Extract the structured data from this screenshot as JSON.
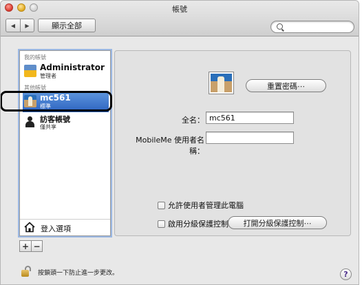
{
  "window": {
    "title": "帳號"
  },
  "toolbar": {
    "back_glyph": "◀",
    "forward_glyph": "▶",
    "show_all_label": "顯示全部",
    "search_placeholder": ""
  },
  "sidebar": {
    "my_account_header": "我的帳號",
    "other_accounts_header": "其他帳號",
    "accounts": [
      {
        "name": "Administrator",
        "role": "管理者",
        "icon": "sunflower-picture-icon"
      },
      {
        "name": "mc561",
        "role": "標準",
        "icon": "chess-picture-icon",
        "selected": true
      },
      {
        "name": "訪客帳號",
        "role": "僅共享",
        "icon": "guest-silhouette-icon"
      }
    ],
    "login_options_label": "登入選項",
    "add_label": "+",
    "remove_label": "−"
  },
  "panel": {
    "reset_password_label": "重置密碼⋯",
    "full_name_label": "全名：",
    "full_name_value": "mc561",
    "mobileme_label": "MobileMe 使用者名稱：",
    "mobileme_value": "",
    "allow_admin_label": "允許使用者管理此電腦",
    "allow_admin_checked": false,
    "parental_controls_label": "啟用分級保護控制",
    "parental_controls_checked": false,
    "open_parental_label": "打開分級保護控制⋯"
  },
  "footer": {
    "lock_text": "按鎖頭一下防止進一步更改。",
    "help_label": "?"
  },
  "colors": {
    "selection": "#2d63c0",
    "focus_ring": "#9bb8e3"
  }
}
